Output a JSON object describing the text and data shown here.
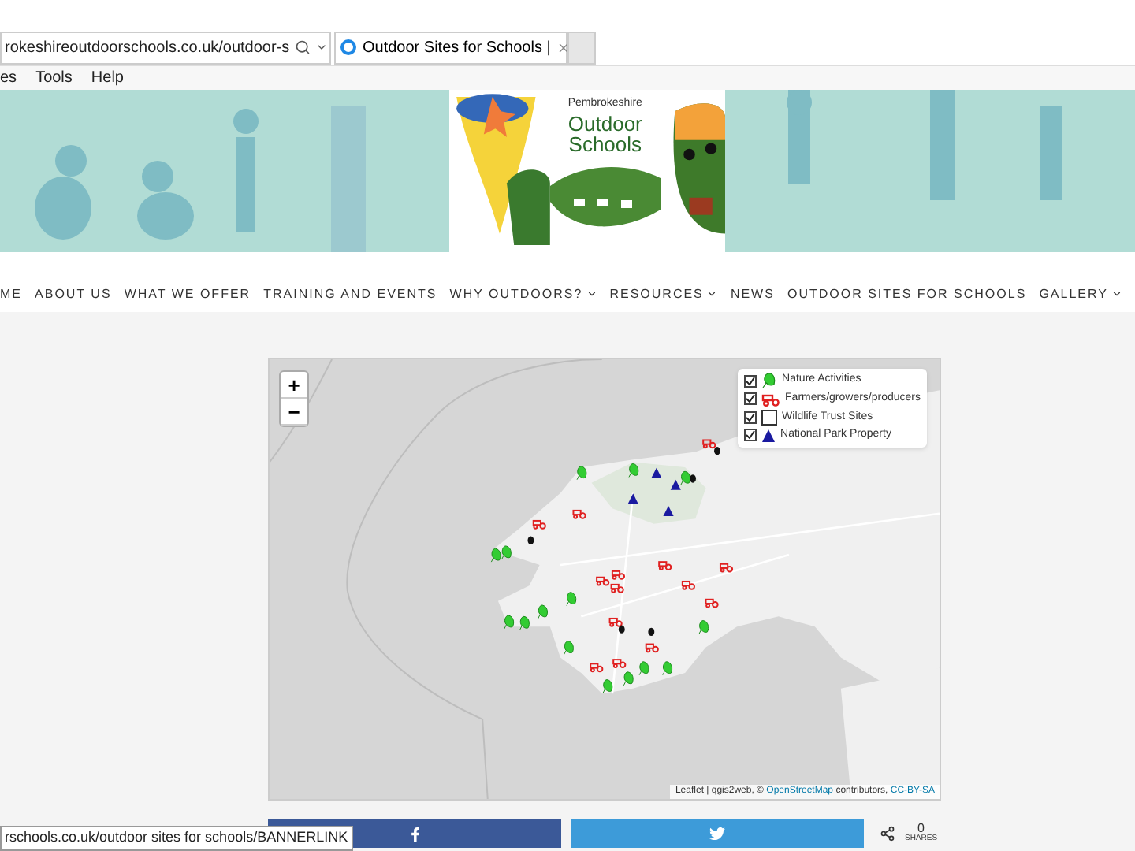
{
  "browser": {
    "url": "rokeshireoutdoorschools.co.uk/outdoor-s",
    "tab_title": "Outdoor Sites for Schools |",
    "menu": [
      "es",
      "Tools",
      "Help"
    ]
  },
  "logo": {
    "tagline": "Pembrokeshire",
    "name": [
      "Outdoor",
      "Schools"
    ]
  },
  "nav": [
    {
      "label": "ME",
      "dropdown": false
    },
    {
      "label": "ABOUT US",
      "dropdown": false
    },
    {
      "label": "WHAT WE OFFER",
      "dropdown": false
    },
    {
      "label": "TRAINING AND EVENTS",
      "dropdown": false
    },
    {
      "label": "WHY OUTDOORS?",
      "dropdown": true
    },
    {
      "label": "RESOURCES",
      "dropdown": true
    },
    {
      "label": "NEWS",
      "dropdown": false
    },
    {
      "label": "OUTDOOR SITES FOR SCHOOLS",
      "dropdown": false
    },
    {
      "label": "GALLERY",
      "dropdown": true
    }
  ],
  "map": {
    "zoom_buttons": [
      "+",
      "−"
    ],
    "layers": [
      {
        "label": "Nature Activities",
        "checked": true,
        "kind": "leaf"
      },
      {
        "label": "Farmers/growers/producers",
        "checked": true,
        "kind": "tractor"
      },
      {
        "label": "Wildlife Trust Sites",
        "checked": true,
        "kind": "square"
      },
      {
        "label": "National Park Property",
        "checked": true,
        "kind": "triangle"
      }
    ],
    "attribution": {
      "prefix": "Leaflet | qgis2web, ©",
      "link": "OpenStreetMap",
      "middle": "contributors,",
      "license": "CC-BY-SA"
    }
  },
  "share": {
    "count": "0",
    "label": "SHARES"
  },
  "status_url": "rschools.co.uk/outdoor sites for schools/BANNERLINK"
}
